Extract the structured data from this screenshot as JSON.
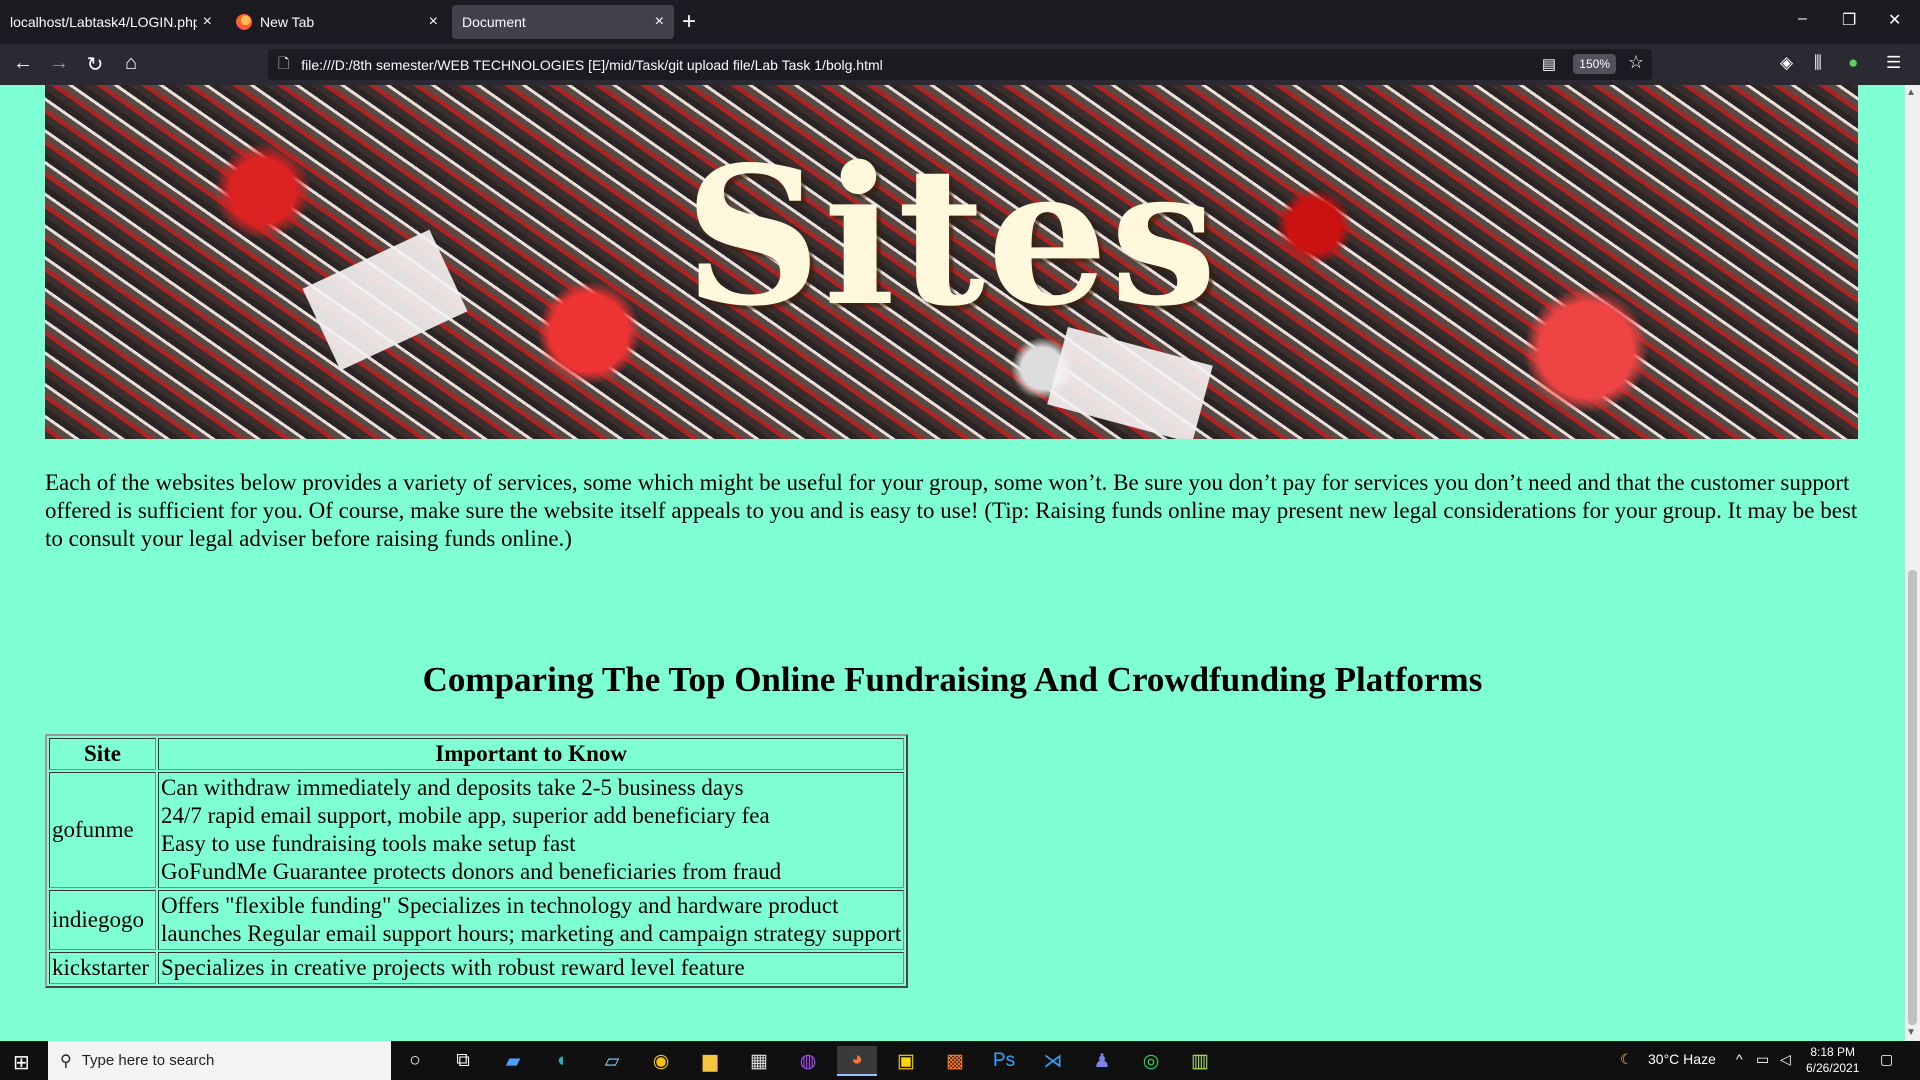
{
  "browser": {
    "tabs": [
      {
        "label": "localhost/Labtask4/LOGIN.php",
        "active": false
      },
      {
        "label": "New Tab",
        "active": false
      },
      {
        "label": "Document",
        "active": true
      }
    ],
    "new_tab_glyph": "+",
    "close_glyph": "×",
    "url": "file:///D:/8th semester/WEB TECHNOLOGIES [E]/mid/Task/git upload file/Lab Task 1/bolg.html",
    "zoom": "150%",
    "window_controls": {
      "minimize": "–",
      "restore": "❐",
      "close": "✕"
    }
  },
  "page": {
    "hero_title": "Sites",
    "intro": "Each of the websites below provides a variety of services, some which might be useful for your group, some won’t. Be sure you don’t pay for services you don’t need and that the customer support offered is sufficient for you. Of course, make sure the website itself appeals to you and is easy to use! (Tip: Raising funds online may present new legal considerations for your group. It may be best to consult your legal adviser before raising funds online.)",
    "heading": "Comparing The Top Online Fundraising And Crowdfunding Platforms",
    "table": {
      "headers": [
        "Site",
        "Important to Know"
      ],
      "rows": [
        {
          "site": "gofunme",
          "lines": [
            "Can withdraw immediately and deposits take 2-5 business days",
            "24/7 rapid email support, mobile app, superior add beneficiary fea",
            "Easy to use fundraising tools make setup fast",
            "GoFundMe Guarantee protects donors and beneficiaries from fraud"
          ]
        },
        {
          "site": "indiegogo",
          "lines": [
            "Offers \"flexible funding\" Specializes in technology and hardware product",
            "launches Regular email support hours; marketing and campaign strategy support"
          ]
        },
        {
          "site": "kickstarter",
          "lines": [
            "Specializes in creative projects with robust reward level feature"
          ]
        }
      ]
    }
  },
  "taskbar": {
    "search_placeholder": "Type here to search",
    "weather": "30°C  Haze",
    "time": "8:18 PM",
    "date": "6/26/2021"
  }
}
